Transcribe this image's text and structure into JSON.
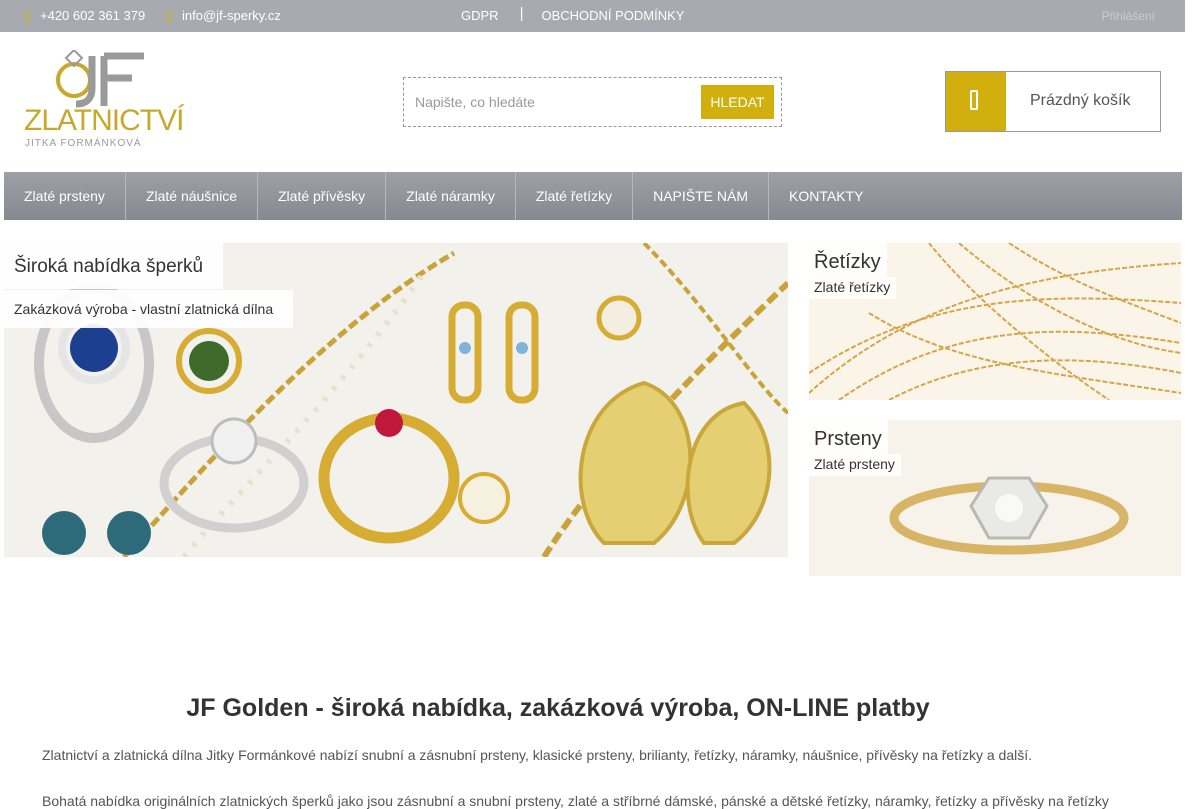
{
  "topbar": {
    "phone": "+420 602 361 379",
    "email": "info@jf-sperky.cz",
    "links": [
      "GDPR",
      "OBCHODNÍ PODMÍNKY"
    ],
    "separator": "|",
    "login": "Přihlášení"
  },
  "logo": {
    "monogram": "JF",
    "name": "ZLATNICTVÍ",
    "subtitle": "JITKA FORMÁNKOVÁ"
  },
  "search": {
    "placeholder": "Napište, co hledáte",
    "button_label": "HLEDAT"
  },
  "cart": {
    "label": "Prázdný košík",
    "icon": "shopping-bag-icon"
  },
  "nav": {
    "items": [
      "Zlaté prsteny",
      "Zlaté náušnice",
      "Zlaté přívěsky",
      "Zlaté náramky",
      "Zlaté řetízky",
      "NAPIŠTE NÁM",
      "KONTAKTY"
    ]
  },
  "slider": {
    "title": "Široká nabídka šperků",
    "subtitle": "Zakázková výroba - vlastní zlatnická dílna"
  },
  "tiles": [
    {
      "title": "Řetízky",
      "subtitle": "Zlaté řetízky"
    },
    {
      "title": "Prsteny",
      "subtitle": "Zlaté prsteny"
    }
  ],
  "content": {
    "headline": "JF Golden - široká nabídka, zakázková výroba, ON-LINE platby",
    "paragraph1": "Zlatnictví a zlatnická dílna Jitky Formánkové nabízí snubní a zásnubní prsteny, klasické prsteny, brilianty, řetízky, náramky, náušnice, přívěsky na řetízky a další.",
    "paragraph2": "Bohatá nabídka originálních zlatnických šperků jako jsou zásnubní a snubní prsteny, zlaté a stříbrné dámské, pánské a dětské řetízky, náramky, řetízky a přívěsky na řetízky"
  },
  "colors": {
    "accent_gold": "#d1af0f",
    "topbar_gray": "#a7aab0",
    "nav_gray": "#8f9298"
  }
}
